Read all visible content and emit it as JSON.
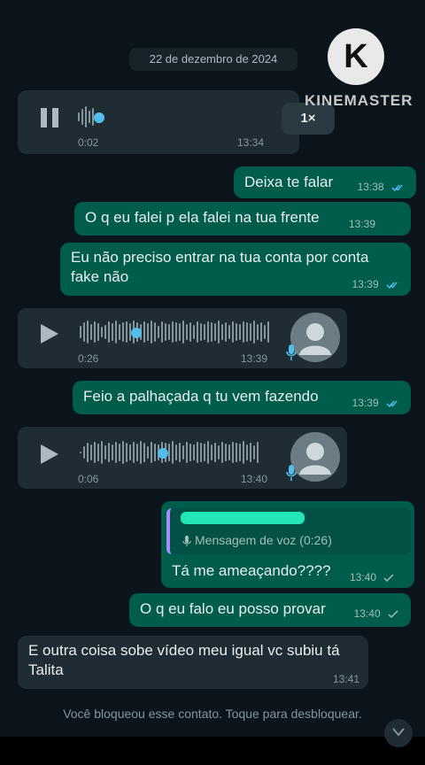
{
  "date_chip": "22 de dezembro de 2024",
  "watermark": {
    "logo_letter": "K",
    "text": "KINEMASTER"
  },
  "voice_1": {
    "elapsed": "0:02",
    "time": "13:34",
    "speed": "1×",
    "progress": 0.08
  },
  "messages": [
    {
      "text": "Deixa te falar",
      "time": "13:38"
    },
    {
      "text": "O q eu falei p ela falei na tua frente",
      "time": "13:39"
    },
    {
      "text": "Eu não preciso entrar na tua conta por conta fake não",
      "time": "13:39"
    },
    {
      "text": "Feio a palhaçada q tu vem fazendo",
      "time": "13:39"
    },
    {
      "text": "Tá me ameaçando????",
      "time": "13:40"
    },
    {
      "text": "O q eu falo eu posso provar",
      "time": "13:40"
    },
    {
      "text": "E outra coisa sobe vídeo meu igual vc subiu tá Talita",
      "time": "13:41"
    }
  ],
  "voice_2": {
    "duration": "0:26",
    "time": "13:39",
    "progress": 0.3
  },
  "voice_3": {
    "duration": "0:06",
    "time": "13:40",
    "progress": 0.42
  },
  "reply_quote": {
    "text": "Mensagem de voz (0:26)"
  },
  "system_note": "Você bloqueou esse contato. Toque para desbloquear.",
  "colors": {
    "outgoing": "#005c4b",
    "incoming": "#202c33",
    "read_ticks": "#53bdeb",
    "accent": "#53bdeb"
  }
}
